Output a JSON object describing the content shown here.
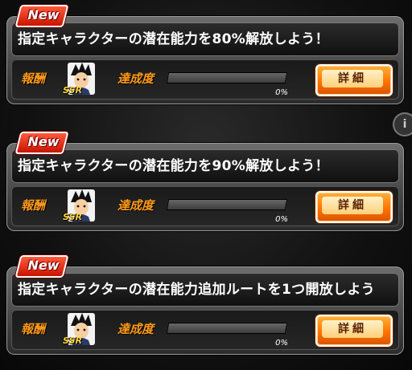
{
  "badge_label": "New",
  "reward_label": "報酬",
  "progress_label": "達成度",
  "detail_button_label": "詳細",
  "info_icon_glyph": "i",
  "colors": {
    "accent_orange": "#ff7300",
    "label_orange": "#ff9b1a",
    "badge_red": "#c81400"
  },
  "missions": [
    {
      "title": "指定キャラクターの潜在能力を80%解放しよう！",
      "reward_rarity": "SSR",
      "progress_percent": 0,
      "progress_text": "0%"
    },
    {
      "title": "指定キャラクターの潜在能力を90%解放しよう！",
      "reward_rarity": "SSR",
      "progress_percent": 0,
      "progress_text": "0%"
    },
    {
      "title": "指定キャラクターの潜在能力追加ルートを1つ開放しよう",
      "reward_rarity": "SSR",
      "progress_percent": 0,
      "progress_text": "0%"
    }
  ]
}
